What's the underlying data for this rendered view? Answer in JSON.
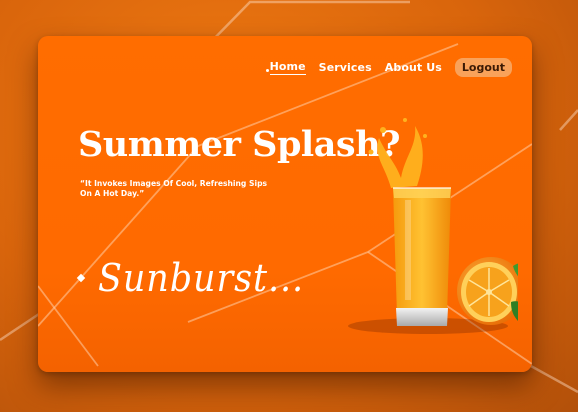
{
  "nav": {
    "items": [
      {
        "label": "Home",
        "active": true
      },
      {
        "label": "Services",
        "active": false
      },
      {
        "label": "About Us",
        "active": false
      }
    ],
    "logout_label": "Logout"
  },
  "hero": {
    "title": "Summer Splash?",
    "quote": "“It Invokes Images Of Cool, Refreshing Sips On A Hot Day.”",
    "tagline": "Sunburst..."
  },
  "colors": {
    "background": "#e06a0e",
    "card": "#ff6a00",
    "logout_button": "#f9a25a",
    "text": "#ffffff"
  },
  "icons": {
    "tagline_bullet": "diamond-icon",
    "hero_art": "juice-glass-with-orange"
  }
}
